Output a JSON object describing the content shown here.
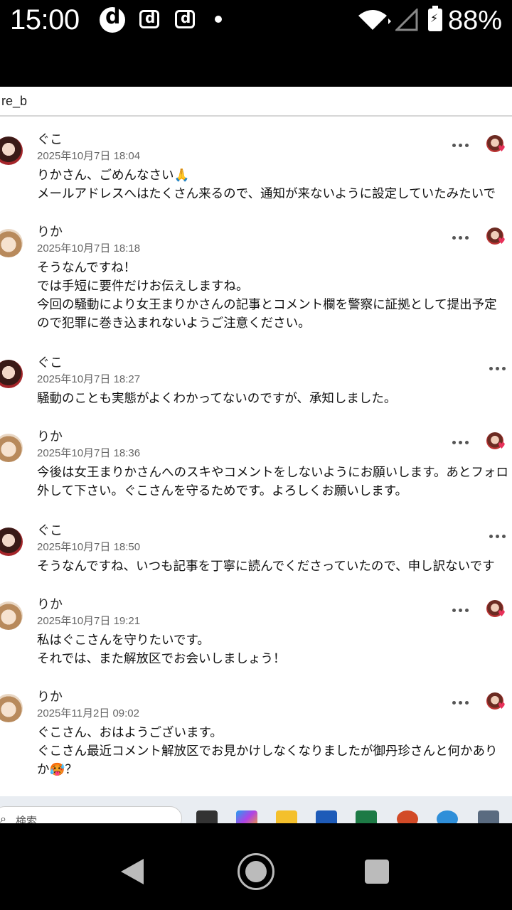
{
  "status_bar": {
    "time": "15:00",
    "notif_icons": [
      "d-account-icon",
      "d-square-icon",
      "d-square-icon"
    ],
    "battery": "88%"
  },
  "page": {
    "username_fragment": "re_b"
  },
  "comments": [
    {
      "author": "ぐこ",
      "avatar": "guko",
      "date": "2025年10月7日 18:04",
      "lines": [
        "りかさん、ごめんなさい🙏",
        "メールアドレスへはたくさん来るので、通知が来ないように設定していたみたいで"
      ],
      "liked": true
    },
    {
      "author": "りか",
      "avatar": "rika",
      "date": "2025年10月7日 18:18",
      "lines": [
        "そうなんですね！",
        "では手短に要件だけお伝えしますね。",
        "今回の騒動により女王まりかさんの記事とコメント欄を警察に証拠として提出予定",
        "ので犯罪に巻き込まれないようご注意ください。"
      ],
      "liked": true
    },
    {
      "author": "ぐこ",
      "avatar": "guko",
      "date": "2025年10月7日 18:27",
      "lines": [
        "騒動のことも実態がよくわかってないのですが、承知しました。"
      ],
      "liked": false
    },
    {
      "author": "りか",
      "avatar": "rika",
      "date": "2025年10月7日 18:36",
      "lines": [
        "今後は女王まりかさんへのスキやコメントをしないようにお願いします。あとフォロ",
        "外して下さい。ぐこさんを守るためです。よろしくお願いします。"
      ],
      "liked": true
    },
    {
      "author": "ぐこ",
      "avatar": "guko",
      "date": "2025年10月7日 18:50",
      "lines": [
        "そうなんですね、いつも記事を丁寧に読んでくださっていたので、申し訳ないです"
      ],
      "liked": false
    },
    {
      "author": "りか",
      "avatar": "rika",
      "date": "2025年10月7日 19:21",
      "lines": [
        "私はぐこさんを守りたいです。",
        "それでは、また解放区でお会いしましょう！"
      ],
      "liked": true
    },
    {
      "author": "りか",
      "avatar": "rika",
      "date": "2025年11月2日 09:02",
      "lines": [
        "ぐこさん、おはようございます。",
        "ぐこさん最近コメント解放区でお見かけしなくなりましたが御丹珍さんと何かあり",
        "か🥵？"
      ],
      "liked": true
    }
  ],
  "taskbar": {
    "search_placeholder": "検索",
    "apps": [
      "file-explorer-icon",
      "copilot-icon",
      "folder-icon",
      "word-icon",
      "excel-icon",
      "powerpoint-icon",
      "browser-icon",
      "calculator-icon"
    ]
  },
  "nav": {
    "buttons": [
      "back-icon",
      "home-icon",
      "recents-icon"
    ]
  }
}
